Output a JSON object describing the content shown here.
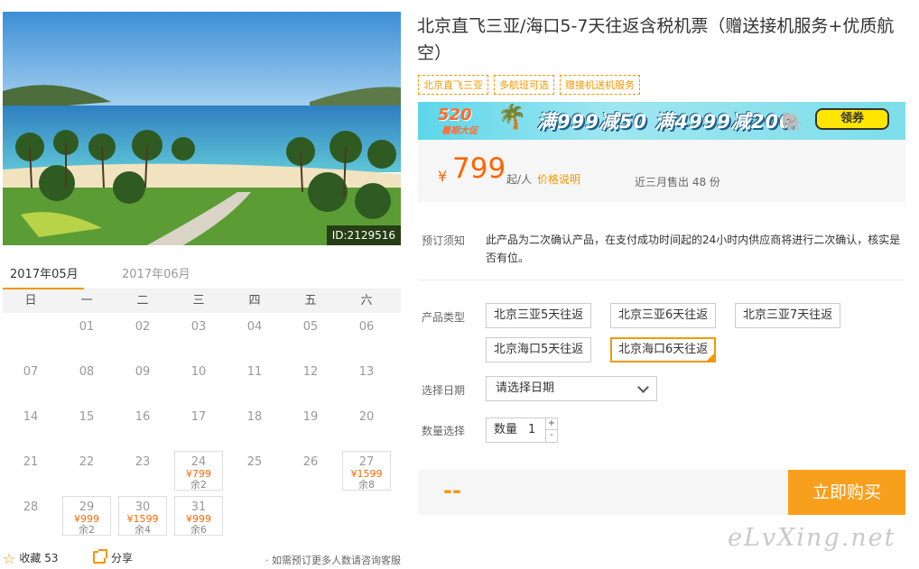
{
  "hero": {
    "image_id": "ID:2129516"
  },
  "calendar": {
    "months": [
      "2017年05月",
      "2017年06月"
    ],
    "active_month": 0,
    "weekdays": [
      "日",
      "一",
      "二",
      "三",
      "四",
      "五",
      "六"
    ],
    "days": [
      {
        "day": "",
        "col": 1,
        "row": 1
      },
      {
        "day": "01",
        "col": 2,
        "row": 1
      },
      {
        "day": "02",
        "col": 3,
        "row": 1
      },
      {
        "day": "03",
        "col": 4,
        "row": 1
      },
      {
        "day": "04",
        "col": 5,
        "row": 1
      },
      {
        "day": "05",
        "col": 6,
        "row": 1
      },
      {
        "day": "06",
        "col": 7,
        "row": 1
      },
      {
        "day": "07",
        "col": 1,
        "row": 2
      },
      {
        "day": "08",
        "col": 2,
        "row": 2
      },
      {
        "day": "09",
        "col": 3,
        "row": 2
      },
      {
        "day": "10",
        "col": 4,
        "row": 2
      },
      {
        "day": "11",
        "col": 5,
        "row": 2
      },
      {
        "day": "12",
        "col": 6,
        "row": 2
      },
      {
        "day": "13",
        "col": 7,
        "row": 2
      },
      {
        "day": "14",
        "col": 1,
        "row": 3
      },
      {
        "day": "15",
        "col": 2,
        "row": 3
      },
      {
        "day": "16",
        "col": 3,
        "row": 3
      },
      {
        "day": "17",
        "col": 4,
        "row": 3
      },
      {
        "day": "18",
        "col": 5,
        "row": 3
      },
      {
        "day": "19",
        "col": 6,
        "row": 3
      },
      {
        "day": "20",
        "col": 7,
        "row": 3
      },
      {
        "day": "21",
        "col": 1,
        "row": 4
      },
      {
        "day": "22",
        "col": 2,
        "row": 4
      },
      {
        "day": "23",
        "col": 3,
        "row": 4
      },
      {
        "day": "24",
        "col": 4,
        "row": 4,
        "price": "¥799",
        "remain": "余2"
      },
      {
        "day": "25",
        "col": 5,
        "row": 4
      },
      {
        "day": "26",
        "col": 6,
        "row": 4
      },
      {
        "day": "27",
        "col": 7,
        "row": 4,
        "price": "¥1599",
        "remain": "余8"
      },
      {
        "day": "28",
        "col": 1,
        "row": 5
      },
      {
        "day": "29",
        "col": 2,
        "row": 5,
        "price": "¥999",
        "remain": "余2"
      },
      {
        "day": "30",
        "col": 3,
        "row": 5,
        "price": "¥1599",
        "remain": "余4"
      },
      {
        "day": "31",
        "col": 4,
        "row": 5,
        "price": "¥999",
        "remain": "余6"
      }
    ]
  },
  "footer": {
    "favorite_label": "收藏",
    "favorite_count": "53",
    "share_label": "分享",
    "note": "· 如需预订更多人数请咨询客服"
  },
  "product": {
    "title": "北京直飞三亚/海口5-7天往返含税机票（赠送接机服务+优质航空）",
    "tags": [
      "北京直飞三亚",
      "多航班可选",
      "赠接机送机服务"
    ]
  },
  "banner": {
    "logo_main": "520",
    "logo_sub": "暑期大促",
    "deal_text": "满999减50 满4999减200",
    "coupon_label": "领券"
  },
  "price": {
    "currency": "¥",
    "amount": "799",
    "unit": "起/人",
    "note": "价格说明",
    "sold": "近三月售出 48 份"
  },
  "booking": {
    "notice_label": "预订须知",
    "notice_text": "此产品为二次确认产品，在支付成功时间起的24小时内供应商将进行二次确认，核实是否有位。",
    "type_label": "产品类型",
    "types": [
      "北京三亚5天往返",
      "北京三亚6天往返",
      "北京三亚7天往返",
      "北京海口5天往返",
      "北京海口6天往返"
    ],
    "selected_type": 4,
    "date_label": "选择日期",
    "date_placeholder": "请选择日期",
    "qty_label": "数量选择",
    "qty_text": "数量",
    "qty_value": "1",
    "qty_plus": "+",
    "qty_minus": "-",
    "total": "--",
    "buy_label": "立即购买"
  },
  "watermark": "eLvXing.net",
  "colors": {
    "accent": "#f39800",
    "price": "#ff6600",
    "buy_button": "#f8a01e"
  }
}
